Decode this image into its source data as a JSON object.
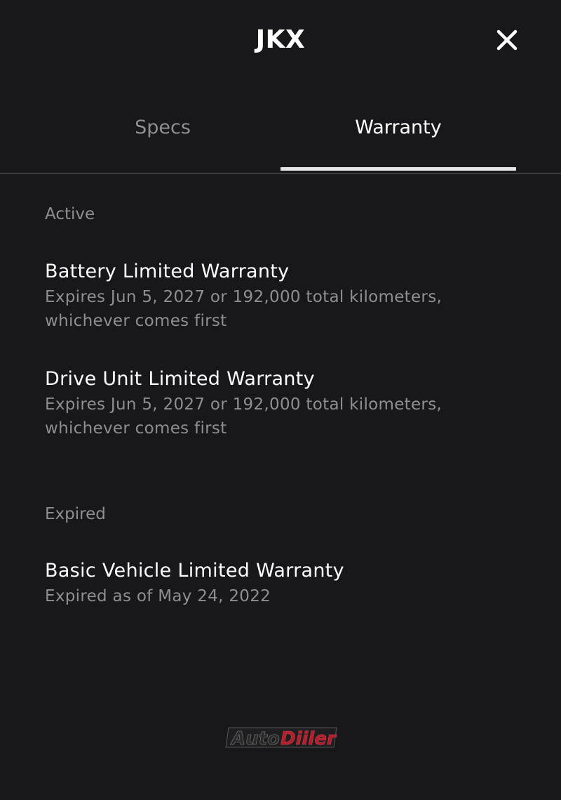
{
  "header": {
    "title": "JKX",
    "close_icon": "close-icon"
  },
  "tabs": [
    {
      "label": "Specs",
      "active": false
    },
    {
      "label": "Warranty",
      "active": true
    }
  ],
  "sections": {
    "active": {
      "label": "Active",
      "items": [
        {
          "title": "Battery Limited Warranty",
          "description": "Expires Jun 5, 2027 or 192,000 total kilometers, whichever comes first"
        },
        {
          "title": "Drive Unit Limited Warranty",
          "description": "Expires Jun 5, 2027 or 192,000 total kilometers, whichever comes first"
        }
      ]
    },
    "expired": {
      "label": "Expired",
      "items": [
        {
          "title": "Basic Vehicle Limited Warranty",
          "description": "Expired as of May 24, 2022"
        }
      ]
    }
  },
  "watermark": {
    "text_part1": "Auto",
    "text_part2": "Diiler",
    "color_part1": "#2a2a2a",
    "color_part2": "#b0202a"
  },
  "colors": {
    "background": "#18181a",
    "text_primary": "#ffffff",
    "text_secondary": "#8e8e93",
    "divider": "#3c3c3f",
    "tab_indicator": "#e5e5e5"
  }
}
